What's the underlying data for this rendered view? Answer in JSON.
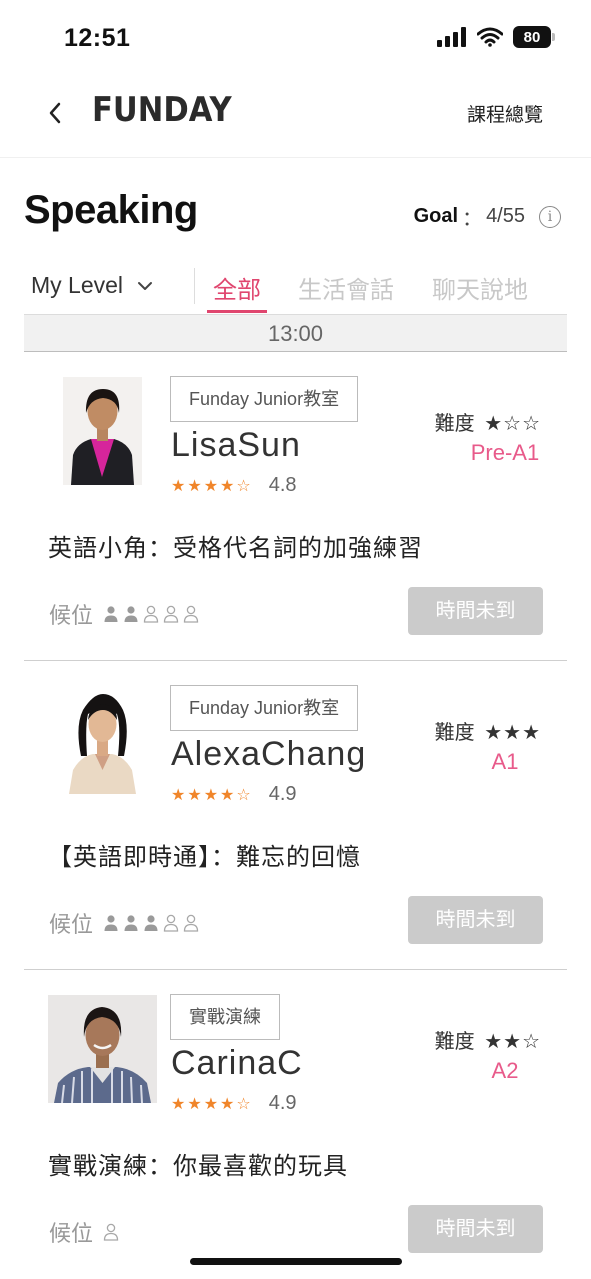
{
  "status_bar": {
    "time": "12:51",
    "battery": "80"
  },
  "nav": {
    "logo": "FUNDAY",
    "overview_link": "課程總覽"
  },
  "header": {
    "title": "Speaking",
    "goal_label": "Goal",
    "goal_sep": "：",
    "goal_value": "4/55"
  },
  "filters": {
    "level": "My Level",
    "tabs": [
      {
        "label": "全部",
        "active": true
      },
      {
        "label": "生活會話",
        "active": false
      },
      {
        "label": "聊天說地",
        "active": false
      }
    ]
  },
  "time_slot": "13:00",
  "waitlist_label": "候位",
  "courses": [
    {
      "tag": "Funday Junior教室",
      "teacher": "LisaSun",
      "rating_stars": "★★★★☆",
      "rating_value": "4.8",
      "difficulty_label": "難度",
      "difficulty_stars": "★☆☆",
      "level": "Pre-A1",
      "title": "英語小角：受格代名詞的加強練習",
      "seats_filled": 2,
      "seats_total": 5,
      "button": "時間未到"
    },
    {
      "tag": "Funday Junior教室",
      "teacher": "AlexaChang",
      "rating_stars": "★★★★☆",
      "rating_value": "4.9",
      "difficulty_label": "難度",
      "difficulty_stars": "★★★",
      "level": "A1",
      "title": "【英語即時通】：難忘的回憶",
      "seats_filled": 3,
      "seats_total": 5,
      "button": "時間未到"
    },
    {
      "tag": "實戰演練",
      "teacher": "CarinaC",
      "rating_stars": "★★★★☆",
      "rating_value": "4.9",
      "difficulty_label": "難度",
      "difficulty_stars": "★★☆",
      "level": "A2",
      "title": "實戰演練：你最喜歡的玩具",
      "seats_filled": 0,
      "seats_total": 1,
      "button": "時間未到"
    }
  ]
}
